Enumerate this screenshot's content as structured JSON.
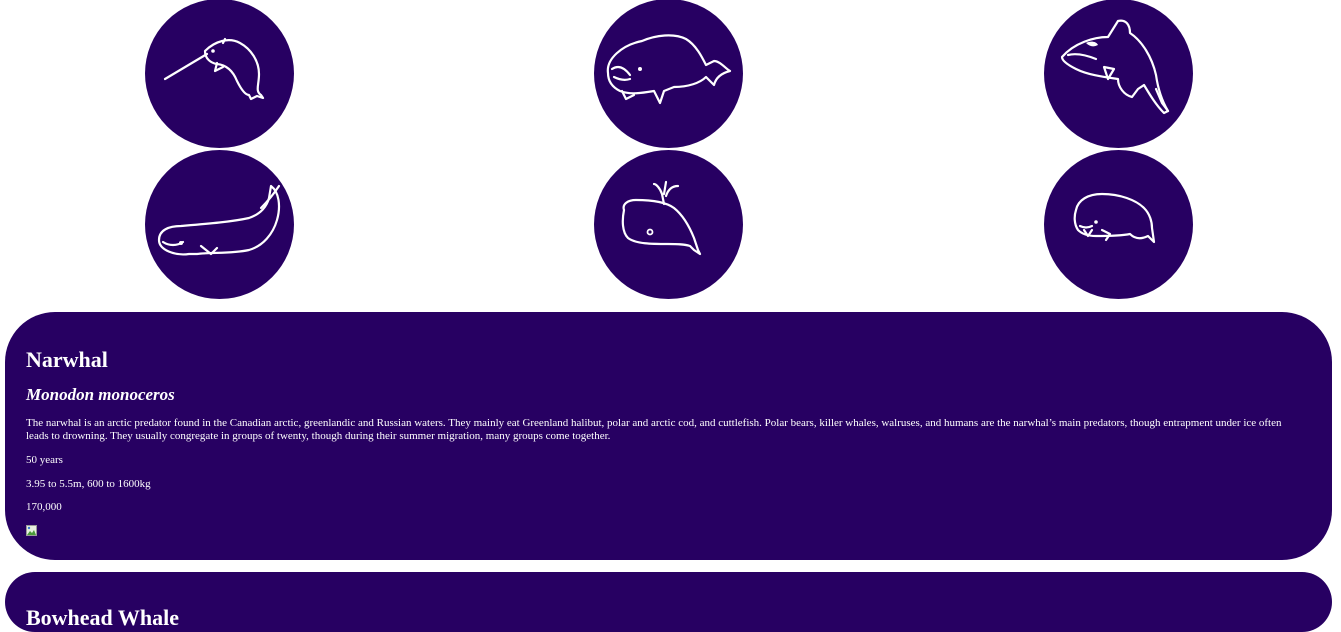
{
  "gallery": {
    "items": [
      {
        "icon": "narwhal-icon"
      },
      {
        "icon": "bowhead-whale-icon"
      },
      {
        "icon": "orca-icon"
      },
      {
        "icon": "beluga-icon"
      },
      {
        "icon": "spouting-whale-icon"
      },
      {
        "icon": "sperm-whale-icon"
      }
    ]
  },
  "cards": [
    {
      "name": "Narwhal",
      "scientific_name": "Monodon monoceros",
      "description": "The narwhal is an arctic predator found in the Canadian arctic, greenlandic and Russian waters. They mainly eat Greenland halibut, polar and arctic cod, and cuttlefish. Polar bears, killer whales, walruses, and humans are the narwhal’s main predators, though entrapment under ice often leads to drowning. They usually congregate in groups of twenty, though during their summer migration, many groups come together.",
      "lifespan": "50 years",
      "size": "3.95 to 5.5m, 600 to 1600kg",
      "population": "170,000"
    },
    {
      "name": "Bowhead Whale"
    }
  ],
  "colors": {
    "accent": "#270062",
    "text": "#ffffff",
    "background": "#ffffff"
  }
}
